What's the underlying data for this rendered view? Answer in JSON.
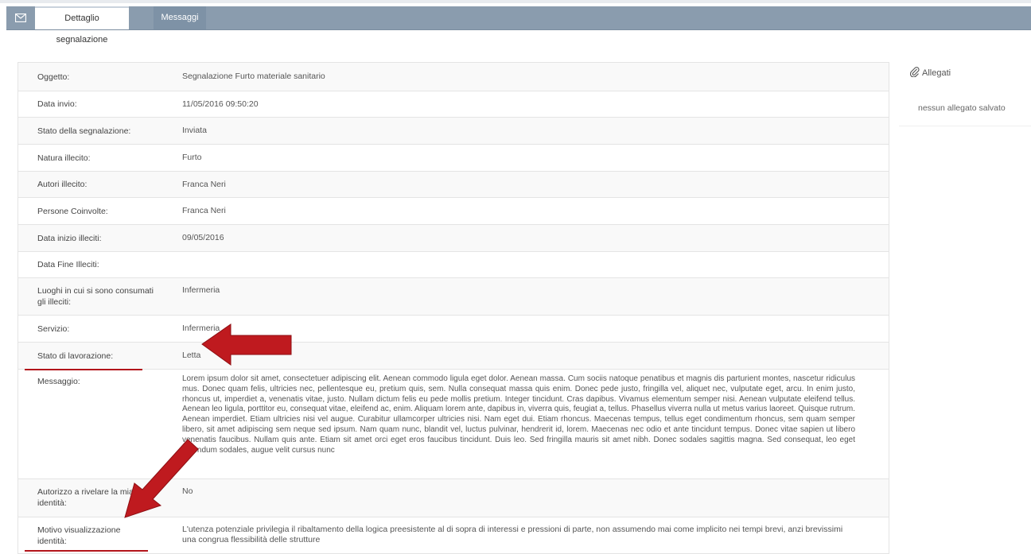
{
  "tabs": [
    {
      "label": "Dettaglio segnalazione",
      "active": true
    },
    {
      "label": "Messaggi",
      "active": false
    }
  ],
  "fields": [
    {
      "label": "Oggetto:",
      "value": "Segnalazione Furto materiale sanitario"
    },
    {
      "label": "Data invio:",
      "value": "11/05/2016 09:50:20"
    },
    {
      "label": "Stato della segnalazione:",
      "value": "Inviata"
    },
    {
      "label": "Natura illecito:",
      "value": "Furto"
    },
    {
      "label": "Autori illecito:",
      "value": "Franca Neri"
    },
    {
      "label": "Persone Coinvolte:",
      "value": "Franca Neri"
    },
    {
      "label": "Data inizio illeciti:",
      "value": "09/05/2016"
    },
    {
      "label": "Data Fine Illeciti:",
      "value": ""
    },
    {
      "label": "Luoghi in cui si sono consumati gli illeciti:",
      "value": "Infermeria"
    },
    {
      "label": "Servizio:",
      "value": "Infermeria"
    },
    {
      "label": "Stato di lavorazione:",
      "value": "Letta"
    },
    {
      "label": "Messaggio:",
      "value": "Lorem ipsum dolor sit amet, consectetuer adipiscing elit. Aenean commodo ligula eget dolor. Aenean massa. Cum sociis natoque penatibus et magnis dis parturient montes, nascetur ridiculus mus. Donec quam felis, ultricies nec, pellentesque eu, pretium quis, sem. Nulla consequat massa quis enim. Donec pede justo, fringilla vel, aliquet nec, vulputate eget, arcu. In enim justo, rhoncus ut, imperdiet a, venenatis vitae, justo. Nullam dictum felis eu pede mollis pretium. Integer tincidunt. Cras dapibus. Vivamus elementum semper nisi. Aenean vulputate eleifend tellus. Aenean leo ligula, porttitor eu, consequat vitae, eleifend ac, enim. Aliquam lorem ante, dapibus in, viverra quis, feugiat a, tellus. Phasellus viverra nulla ut metus varius laoreet. Quisque rutrum. Aenean imperdiet. Etiam ultricies nisi vel augue. Curabitur ullamcorper ultricies nisi. Nam eget dui. Etiam rhoncus. Maecenas tempus, tellus eget condimentum rhoncus, sem quam semper libero, sit amet adipiscing sem neque sed ipsum. Nam quam nunc, blandit vel, luctus pulvinar, hendrerit id, lorem. Maecenas nec odio et ante tincidunt tempus. Donec vitae sapien ut libero venenatis faucibus. Nullam quis ante. Etiam sit amet orci eget eros faucibus tincidunt. Duis leo. Sed fringilla mauris sit amet nibh. Donec sodales sagittis magna. Sed consequat, leo eget bibendum sodales, augue velit cursus nunc"
    },
    {
      "label": "Autorizzo a rivelare la mia identità:",
      "value": "No"
    },
    {
      "label": "Motivo visualizzazione identità:",
      "value": "L'utenza potenziale privilegia il ribaltamento della logica preesistente al di sopra di interessi e pressioni di parte, non assumendo mai come implicito nei tempi brevi, anzi brevissimi una congrua flessibilità delle strutture"
    }
  ],
  "attachments": {
    "title": "Allegati",
    "empty_text": "nessun allegato salvato"
  },
  "colors": {
    "tabbar": "#8a9cae",
    "annotation_red": "#b3151b"
  },
  "icons": {
    "tab_icon": "envelope-icon",
    "attachments_icon": "paperclip-icon"
  }
}
